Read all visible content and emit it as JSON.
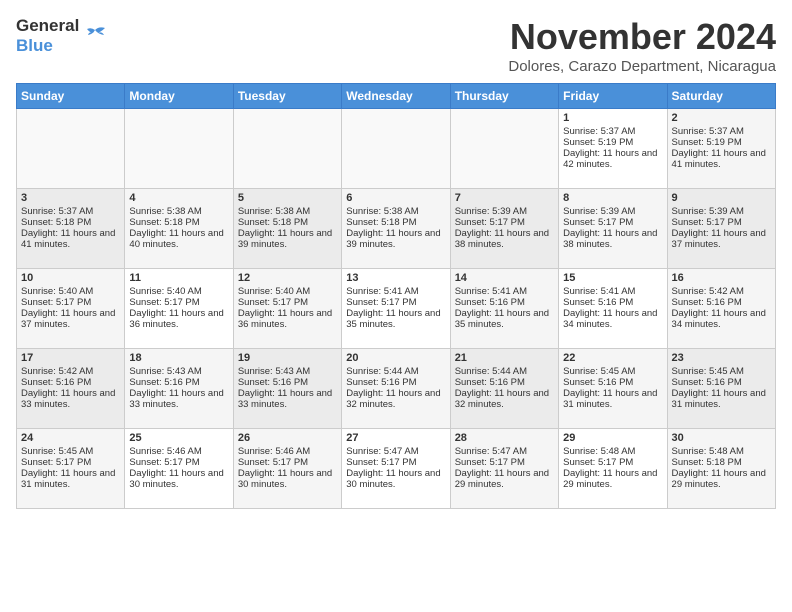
{
  "header": {
    "logo_line1": "General",
    "logo_line2": "Blue",
    "month": "November 2024",
    "location": "Dolores, Carazo Department, Nicaragua"
  },
  "days_of_week": [
    "Sunday",
    "Monday",
    "Tuesday",
    "Wednesday",
    "Thursday",
    "Friday",
    "Saturday"
  ],
  "weeks": [
    [
      {
        "day": "",
        "sunrise": "",
        "sunset": "",
        "daylight": ""
      },
      {
        "day": "",
        "sunrise": "",
        "sunset": "",
        "daylight": ""
      },
      {
        "day": "",
        "sunrise": "",
        "sunset": "",
        "daylight": ""
      },
      {
        "day": "",
        "sunrise": "",
        "sunset": "",
        "daylight": ""
      },
      {
        "day": "",
        "sunrise": "",
        "sunset": "",
        "daylight": ""
      },
      {
        "day": "1",
        "sunrise": "Sunrise: 5:37 AM",
        "sunset": "Sunset: 5:19 PM",
        "daylight": "Daylight: 11 hours and 42 minutes."
      },
      {
        "day": "2",
        "sunrise": "Sunrise: 5:37 AM",
        "sunset": "Sunset: 5:19 PM",
        "daylight": "Daylight: 11 hours and 41 minutes."
      }
    ],
    [
      {
        "day": "3",
        "sunrise": "Sunrise: 5:37 AM",
        "sunset": "Sunset: 5:18 PM",
        "daylight": "Daylight: 11 hours and 41 minutes."
      },
      {
        "day": "4",
        "sunrise": "Sunrise: 5:38 AM",
        "sunset": "Sunset: 5:18 PM",
        "daylight": "Daylight: 11 hours and 40 minutes."
      },
      {
        "day": "5",
        "sunrise": "Sunrise: 5:38 AM",
        "sunset": "Sunset: 5:18 PM",
        "daylight": "Daylight: 11 hours and 39 minutes."
      },
      {
        "day": "6",
        "sunrise": "Sunrise: 5:38 AM",
        "sunset": "Sunset: 5:18 PM",
        "daylight": "Daylight: 11 hours and 39 minutes."
      },
      {
        "day": "7",
        "sunrise": "Sunrise: 5:39 AM",
        "sunset": "Sunset: 5:17 PM",
        "daylight": "Daylight: 11 hours and 38 minutes."
      },
      {
        "day": "8",
        "sunrise": "Sunrise: 5:39 AM",
        "sunset": "Sunset: 5:17 PM",
        "daylight": "Daylight: 11 hours and 38 minutes."
      },
      {
        "day": "9",
        "sunrise": "Sunrise: 5:39 AM",
        "sunset": "Sunset: 5:17 PM",
        "daylight": "Daylight: 11 hours and 37 minutes."
      }
    ],
    [
      {
        "day": "10",
        "sunrise": "Sunrise: 5:40 AM",
        "sunset": "Sunset: 5:17 PM",
        "daylight": "Daylight: 11 hours and 37 minutes."
      },
      {
        "day": "11",
        "sunrise": "Sunrise: 5:40 AM",
        "sunset": "Sunset: 5:17 PM",
        "daylight": "Daylight: 11 hours and 36 minutes."
      },
      {
        "day": "12",
        "sunrise": "Sunrise: 5:40 AM",
        "sunset": "Sunset: 5:17 PM",
        "daylight": "Daylight: 11 hours and 36 minutes."
      },
      {
        "day": "13",
        "sunrise": "Sunrise: 5:41 AM",
        "sunset": "Sunset: 5:17 PM",
        "daylight": "Daylight: 11 hours and 35 minutes."
      },
      {
        "day": "14",
        "sunrise": "Sunrise: 5:41 AM",
        "sunset": "Sunset: 5:16 PM",
        "daylight": "Daylight: 11 hours and 35 minutes."
      },
      {
        "day": "15",
        "sunrise": "Sunrise: 5:41 AM",
        "sunset": "Sunset: 5:16 PM",
        "daylight": "Daylight: 11 hours and 34 minutes."
      },
      {
        "day": "16",
        "sunrise": "Sunrise: 5:42 AM",
        "sunset": "Sunset: 5:16 PM",
        "daylight": "Daylight: 11 hours and 34 minutes."
      }
    ],
    [
      {
        "day": "17",
        "sunrise": "Sunrise: 5:42 AM",
        "sunset": "Sunset: 5:16 PM",
        "daylight": "Daylight: 11 hours and 33 minutes."
      },
      {
        "day": "18",
        "sunrise": "Sunrise: 5:43 AM",
        "sunset": "Sunset: 5:16 PM",
        "daylight": "Daylight: 11 hours and 33 minutes."
      },
      {
        "day": "19",
        "sunrise": "Sunrise: 5:43 AM",
        "sunset": "Sunset: 5:16 PM",
        "daylight": "Daylight: 11 hours and 33 minutes."
      },
      {
        "day": "20",
        "sunrise": "Sunrise: 5:44 AM",
        "sunset": "Sunset: 5:16 PM",
        "daylight": "Daylight: 11 hours and 32 minutes."
      },
      {
        "day": "21",
        "sunrise": "Sunrise: 5:44 AM",
        "sunset": "Sunset: 5:16 PM",
        "daylight": "Daylight: 11 hours and 32 minutes."
      },
      {
        "day": "22",
        "sunrise": "Sunrise: 5:45 AM",
        "sunset": "Sunset: 5:16 PM",
        "daylight": "Daylight: 11 hours and 31 minutes."
      },
      {
        "day": "23",
        "sunrise": "Sunrise: 5:45 AM",
        "sunset": "Sunset: 5:16 PM",
        "daylight": "Daylight: 11 hours and 31 minutes."
      }
    ],
    [
      {
        "day": "24",
        "sunrise": "Sunrise: 5:45 AM",
        "sunset": "Sunset: 5:17 PM",
        "daylight": "Daylight: 11 hours and 31 minutes."
      },
      {
        "day": "25",
        "sunrise": "Sunrise: 5:46 AM",
        "sunset": "Sunset: 5:17 PM",
        "daylight": "Daylight: 11 hours and 30 minutes."
      },
      {
        "day": "26",
        "sunrise": "Sunrise: 5:46 AM",
        "sunset": "Sunset: 5:17 PM",
        "daylight": "Daylight: 11 hours and 30 minutes."
      },
      {
        "day": "27",
        "sunrise": "Sunrise: 5:47 AM",
        "sunset": "Sunset: 5:17 PM",
        "daylight": "Daylight: 11 hours and 30 minutes."
      },
      {
        "day": "28",
        "sunrise": "Sunrise: 5:47 AM",
        "sunset": "Sunset: 5:17 PM",
        "daylight": "Daylight: 11 hours and 29 minutes."
      },
      {
        "day": "29",
        "sunrise": "Sunrise: 5:48 AM",
        "sunset": "Sunset: 5:17 PM",
        "daylight": "Daylight: 11 hours and 29 minutes."
      },
      {
        "day": "30",
        "sunrise": "Sunrise: 5:48 AM",
        "sunset": "Sunset: 5:18 PM",
        "daylight": "Daylight: 11 hours and 29 minutes."
      }
    ]
  ]
}
